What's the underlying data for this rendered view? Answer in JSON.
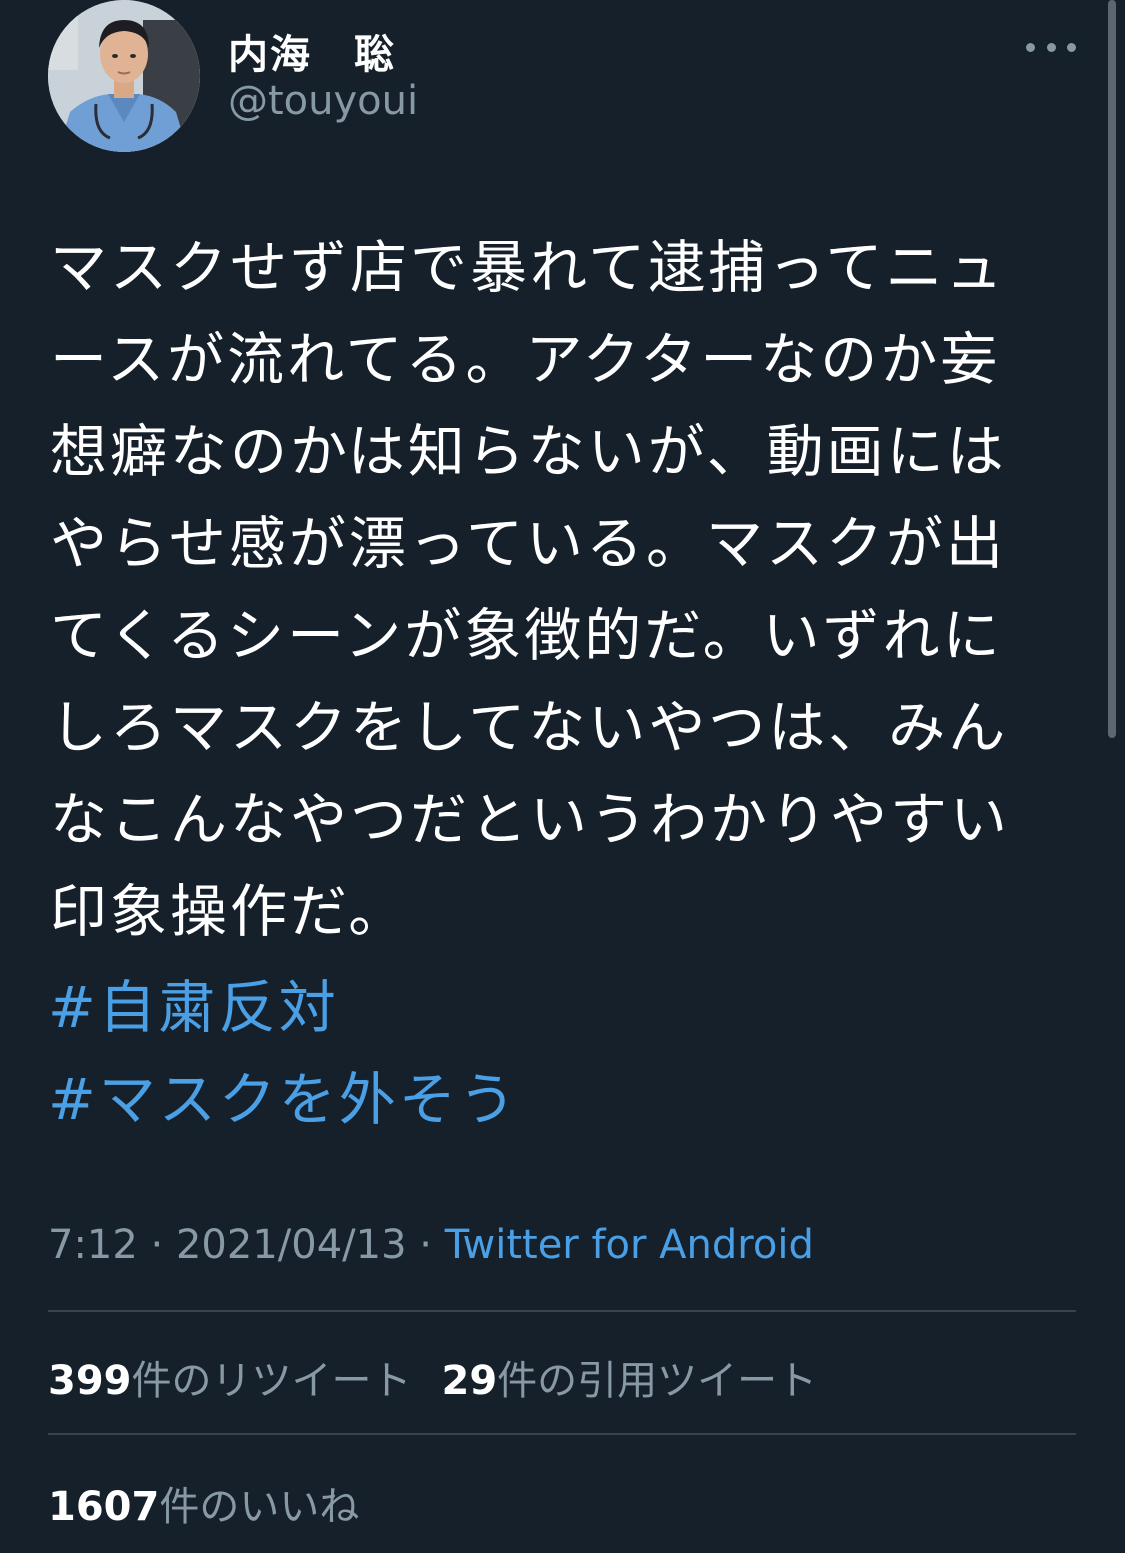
{
  "user": {
    "display_name": "内海　聡",
    "handle": "@touyoui"
  },
  "tweet": {
    "text_lines": [
      "マスクせず店で暴れて逮捕ってニュ",
      "ースが流れてる。アクターなのか妄",
      "想癖なのかは知らないが、動画には",
      "やらせ感が漂っている。マスクが出",
      "てくるシーンが象徴的だ。いずれに",
      "しろマスクをしてないやつは、みん",
      "なこんなやつだというわかりやすい",
      "印象操作だ。"
    ],
    "hashtags": [
      "#自粛反対",
      "#マスクを外そう"
    ]
  },
  "meta": {
    "time": "7:12",
    "date": "2021/04/13",
    "separator": " · ",
    "source": "Twitter for Android"
  },
  "stats": {
    "retweets_count": "399",
    "retweets_label": "件のリツイート",
    "quotes_count": "29",
    "quotes_label": "件の引用ツイート",
    "likes_count": "1607",
    "likes_label": "件のいいね"
  },
  "icons": {
    "more": "more-horizontal-icon"
  },
  "colors": {
    "background": "#15202b",
    "link": "#4a9fe5",
    "secondary_text": "#8899a6",
    "divider": "#38444d"
  }
}
